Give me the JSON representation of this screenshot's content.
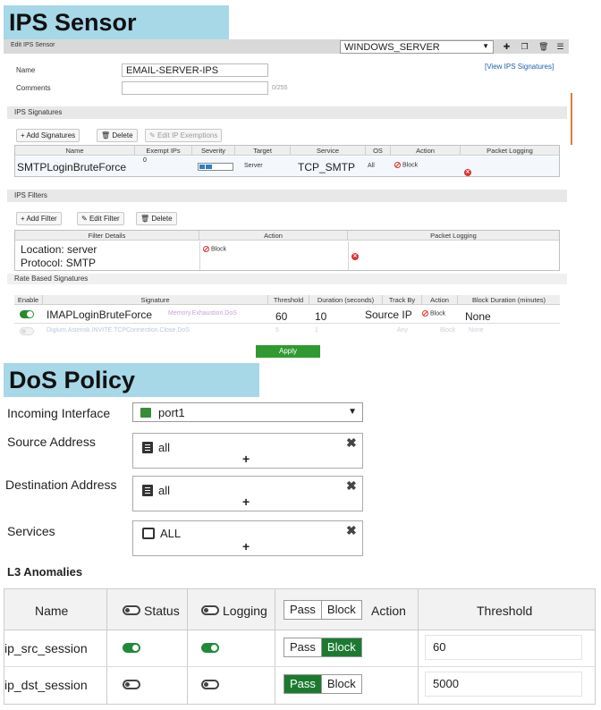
{
  "ips": {
    "title": "IPS Sensor",
    "header_label": "Edit IPS Sensor",
    "sensor_select": "WINDOWS_SERVER",
    "view_link": "[View IPS Signatures]",
    "name_label": "Name",
    "name_value": "EMAIL-SERVER-IPS",
    "comments_label": "Comments",
    "comments_counter": "0/255",
    "signatures_section": "IPS Signatures",
    "sig_buttons": {
      "add": "+ Add Signatures",
      "delete": "Delete",
      "edit": "Edit IP Exemptions"
    },
    "sig_columns": [
      "Name",
      "Exempt IPs",
      "Severity",
      "Target",
      "Service",
      "OS",
      "Action",
      "Packet Logging"
    ],
    "sig_row": {
      "name": "SMTPLoginBruteForce",
      "exempt": "0",
      "severity_level": 0.4,
      "target": "Server",
      "service": "TCP_SMTP",
      "os": "All",
      "action": "Block"
    },
    "filters_section": "IPS Filters",
    "filter_buttons": {
      "add": "+ Add Filter",
      "edit": "Edit Filter",
      "delete": "Delete"
    },
    "filter_columns": [
      "Filter Details",
      "Action",
      "Packet Logging"
    ],
    "filter_row": {
      "location": "Location: server",
      "protocol": "Protocol: SMTP",
      "action": "Block"
    },
    "rate_section": "Rate Based Signatures",
    "rate_columns": [
      "Enable",
      "Signature",
      "Threshold",
      "Duration (seconds)",
      "Track By",
      "Action",
      "Block Duration (minutes)"
    ],
    "rate_rows": [
      {
        "enabled": true,
        "signature": "IMAPLoginBruteForce",
        "overlay": "Memory.Exhaustion.DoS",
        "threshold": "60",
        "duration": "10",
        "track_by": "Source IP",
        "action": "Block",
        "block_duration": "None"
      },
      {
        "enabled": false,
        "signature": "Digium.Asterisk.INVITE.TCPConnection.Close.DoS",
        "overlay": "",
        "threshold": "5",
        "duration": "1",
        "track_by": "Any",
        "action": "Block",
        "block_duration": "None"
      }
    ],
    "apply": "Apply"
  },
  "dos": {
    "title": "DoS Policy",
    "incoming_label": "Incoming Interface",
    "incoming_value": "port1",
    "source_label": "Source Address",
    "source_value": "all",
    "dest_label": "Destination Address",
    "dest_value": "all",
    "services_label": "Services",
    "services_value": "ALL",
    "plus": "+",
    "remove": "✖",
    "l3_title": "L3 Anomalies",
    "l3_headers": {
      "name": "Name",
      "status": "Status",
      "logging": "Logging",
      "pass": "Pass",
      "block": "Block",
      "action": "Action",
      "threshold": "Threshold"
    },
    "l3_rows": [
      {
        "name": "ip_src_session",
        "status": true,
        "logging": true,
        "action": "Block",
        "threshold": "60"
      },
      {
        "name": "ip_dst_session",
        "status": false,
        "logging": false,
        "action": "Pass",
        "threshold": "5000"
      }
    ]
  }
}
